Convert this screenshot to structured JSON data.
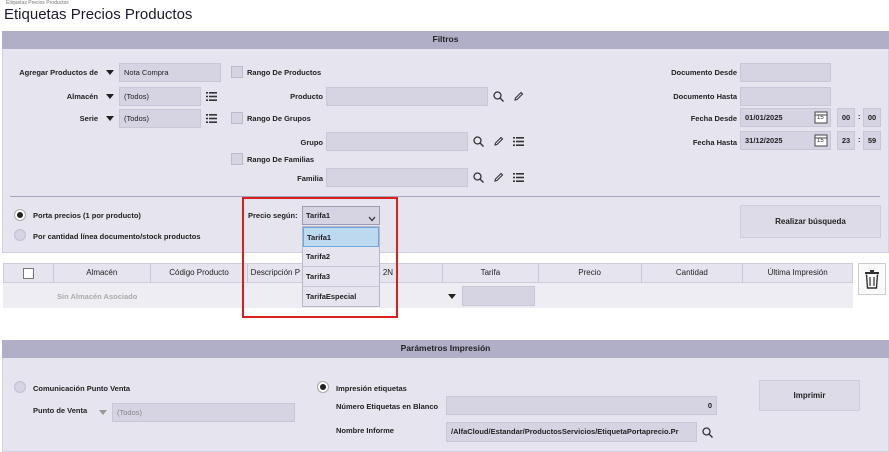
{
  "breadcrumb": "Etiquetas Precios Productos",
  "page_title": "Etiquetas Precios Productos",
  "filtros": {
    "header": "Filtros",
    "agregar_label": "Agregar Productos de",
    "agregar_value": "Nota Compra",
    "almacen_label": "Almacén",
    "almacen_value": "(Todos)",
    "serie_label": "Serie",
    "serie_value": "(Todos)",
    "rango_productos": "Rango De Productos",
    "producto_label": "Producto",
    "rango_grupos": "Rango De Grupos",
    "grupo_label": "Grupo",
    "rango_familias": "Rango De Familias",
    "familia_label": "Familia",
    "documento_desde": "Documento Desde",
    "documento_hasta": "Documento Hasta",
    "fecha_desde_label": "Fecha Desde",
    "fecha_desde_value": "01/01/2025",
    "fecha_desde_h": "00",
    "fecha_desde_m": "00",
    "fecha_hasta_label": "Fecha Hasta",
    "fecha_hasta_value": "31/12/2025",
    "fecha_hasta_h": "23",
    "fecha_hasta_m": "59",
    "calendar_day": "15",
    "time_sep": ":"
  },
  "opciones": {
    "porta_precios": "Porta precios (1 por producto)",
    "por_cantidad": "Por cantidad línea documento/stock productos",
    "precio_segun_label": "Precio según:",
    "precio_segun_value": "Tarifa1",
    "dropdown_options": [
      "Tarifa1",
      "Tarifa2",
      "Tarifa3",
      "TarifaEspecial"
    ],
    "realizar_busqueda": "Realizar búsqueda"
  },
  "table": {
    "columns": [
      "Almacén",
      "Código Producto",
      "Descripción P",
      "rmación 2N",
      "Tarifa",
      "Precio",
      "Cantidad",
      "Última Impresión"
    ],
    "row_almacen": "Sin Almacén Asociado"
  },
  "parametros": {
    "header": "Parámetros Impresión",
    "comunicacion": "Comunicación Punto Venta",
    "punto_venta_label": "Punto de Venta",
    "punto_venta_value": "(Todos)",
    "impresion_etiquetas": "Impresión etiquetas",
    "numero_label": "Número Etiquetas en Blanco",
    "numero_value": "0",
    "nombre_label": "Nombre Informe",
    "nombre_value": "/AlfaCloud/Estandar/ProductosServicios/EtiquetaPortaprecio.Pr",
    "imprimir": "Imprimir"
  },
  "colors": {
    "header_band": "#b1aec8",
    "panel": "#e6e4ef",
    "field": "#d6d3e2",
    "highlight_box": "#d62020",
    "selected_option": "#bcd9ef"
  }
}
